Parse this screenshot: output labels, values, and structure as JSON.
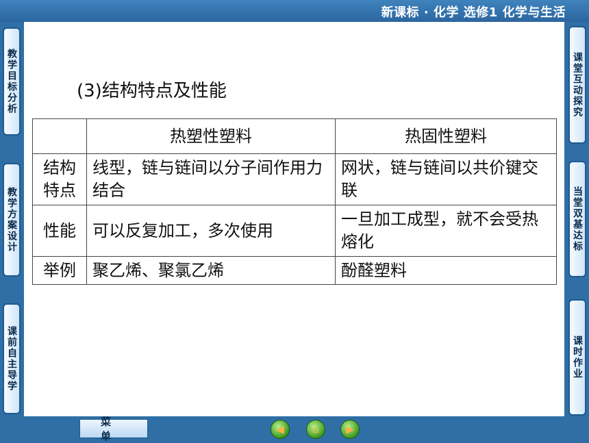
{
  "header": {
    "course_title": "新课标 · 化学  选修1  化学与生活"
  },
  "left_tabs": [
    "教学目标分析",
    "教学方案设计",
    "课前自主导学"
  ],
  "right_tabs": [
    "课堂互动探究",
    "当堂双基达标",
    "课时作业"
  ],
  "section_heading": "(3)结构特点及性能",
  "table": {
    "headers": [
      "",
      "热塑性塑料",
      "热固性塑料"
    ],
    "rows": [
      {
        "label": "结构特点",
        "thermoplastic": "线型，链与链间以分子间作用力结合",
        "thermoset": "网状，链与链间以共价键交联"
      },
      {
        "label": "性能",
        "thermoplastic": "可以反复加工，多次使用",
        "thermoset": "一旦加工成型，就不会受热熔化"
      },
      {
        "label": "举例",
        "thermoplastic": "聚乙烯、聚氯乙烯",
        "thermoset": "酚醛塑料"
      }
    ]
  },
  "footer": {
    "menu_label": "菜单",
    "nav_buttons": [
      "previous-icon",
      "home-icon",
      "next-icon"
    ]
  }
}
